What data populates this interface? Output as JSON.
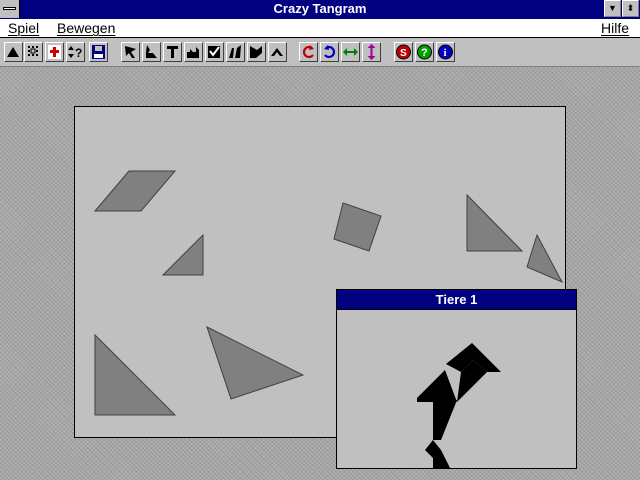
{
  "window": {
    "title": "Crazy Tangram"
  },
  "menu": {
    "items": [
      {
        "label": "Spiel"
      },
      {
        "label": "Bewegen"
      }
    ],
    "help": "Hilfe"
  },
  "toolbar": {
    "tool_icons": [
      "triangle-icon",
      "grid-icon",
      "red-cross-icon",
      "updown-question-icon",
      "floppy-disk-icon"
    ],
    "shape_icons": [
      "arrow-figure-icon",
      "rabbit-figure-icon",
      "hammer-figure-icon",
      "city-figure-icon",
      "check-box-figure-icon",
      "runner-figure-icon",
      "bird-figure-icon",
      "boat-figure-icon"
    ],
    "transform_icons": [
      "rotate-left-icon",
      "rotate-right-icon",
      "flip-horizontal-icon",
      "flip-vertical-icon"
    ],
    "info_icons": [
      "solution-icon",
      "help-icon",
      "info-icon"
    ],
    "colors": {
      "rotate": "#0000c0",
      "rotate_left": "#c00000",
      "flip_h": "#008000",
      "flip_v": "#a000a0"
    }
  },
  "preview": {
    "title": "Tiere 1"
  },
  "colors": {
    "piece_fill": "#808080",
    "silhouette": "#000000",
    "titlebar": "#000080"
  }
}
